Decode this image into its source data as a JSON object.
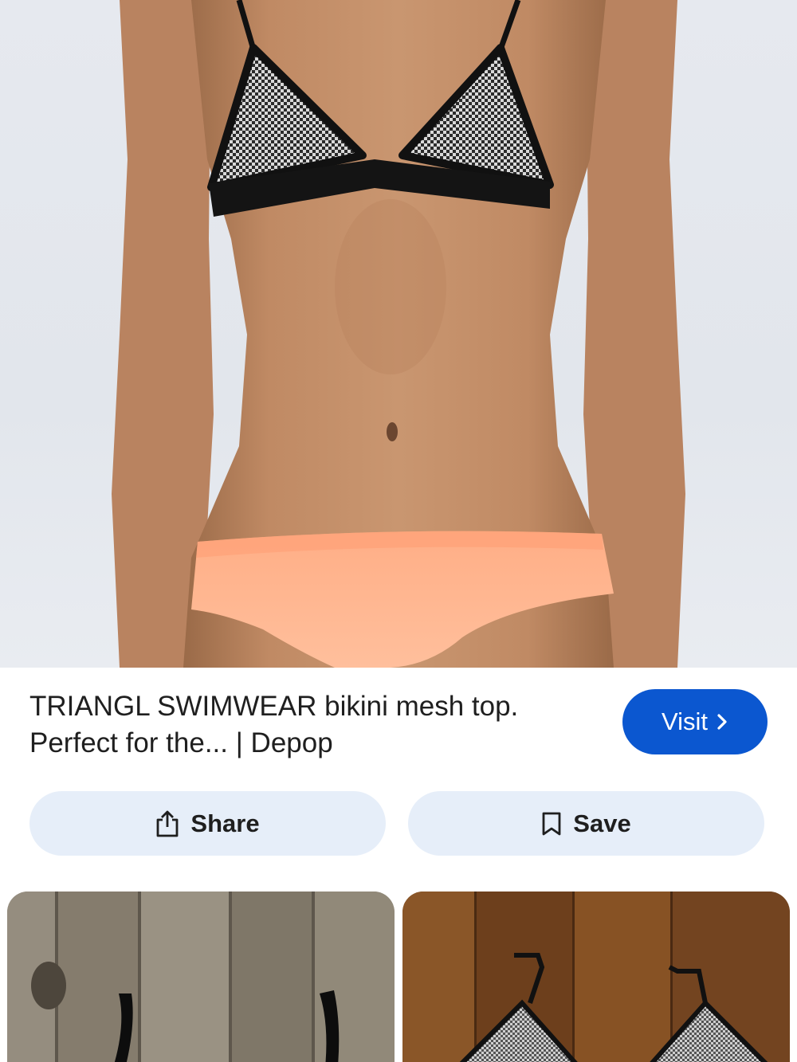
{
  "result": {
    "title": "TRIANGL SWIMWEAR bikini mesh top. Perfect for the... | Depop"
  },
  "actions": {
    "visit_label": "Visit",
    "share_label": "Share",
    "save_label": "Save"
  },
  "icons": {
    "visit": "chevron-right-icon",
    "share": "share-icon",
    "save": "bookmark-icon"
  },
  "colors": {
    "primary_button": "#0b57d0",
    "secondary_button": "#e6eef9",
    "text": "#1f1f1f"
  }
}
